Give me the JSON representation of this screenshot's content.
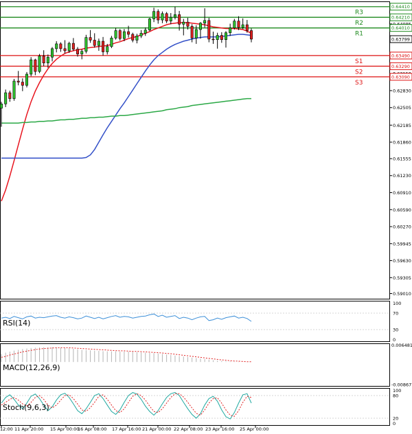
{
  "chart_data": {
    "type": "candlestick",
    "main": {
      "ylim": [
        0.589,
        0.6451
      ],
      "y_ticks": [
        0.6441,
        0.64085,
        0.6379,
        0.6347,
        0.6315,
        0.6283,
        0.6251,
        0.6218,
        0.6186,
        0.6155,
        0.6123,
        0.6091,
        0.6059,
        0.6027,
        0.5995,
        0.5963,
        0.5931,
        0.5901
      ],
      "y_tick_labels": [
        "0.64410",
        "0.64085",
        "0.63799",
        "0.63470",
        "0.63150",
        "0.62830",
        "0.62505",
        "0.62185",
        "0.61860",
        "0.61555",
        "0.61230",
        "0.60910",
        "0.60590",
        "0.60270",
        "0.59945",
        "0.59630",
        "0.59305",
        "0.59010"
      ],
      "levels": [
        {
          "label": "R3",
          "value": 0.6441,
          "tag": "0.64410",
          "color": "#1e8a1e"
        },
        {
          "label": "R2",
          "value": 0.6421,
          "tag": "0.64210",
          "color": "#1e8a1e"
        },
        {
          "label": "R1",
          "value": 0.6401,
          "tag": "0.64010",
          "color": "#1e8a1e"
        },
        {
          "label": "S1",
          "value": 0.6349,
          "tag": "0.63490",
          "color": "#dd1111"
        },
        {
          "label": "S2",
          "value": 0.6329,
          "tag": "0.63290",
          "color": "#dd1111"
        },
        {
          "label": "S3",
          "value": 0.6309,
          "tag": "0.63090",
          "color": "#dd1111"
        }
      ],
      "current_price": {
        "value": 0.63799,
        "tag": "0.63799"
      },
      "candles_ohlc": [
        [
          0.625,
          0.6262,
          0.6215,
          0.6258
        ],
        [
          0.6258,
          0.6285,
          0.6252,
          0.6279
        ],
        [
          0.6279,
          0.6283,
          0.6262,
          0.6268
        ],
        [
          0.6268,
          0.6305,
          0.6264,
          0.6301
        ],
        [
          0.6301,
          0.632,
          0.6293,
          0.6299
        ],
        [
          0.6299,
          0.6306,
          0.6282,
          0.6293
        ],
        [
          0.6293,
          0.6318,
          0.6289,
          0.6314
        ],
        [
          0.6314,
          0.6346,
          0.631,
          0.6341
        ],
        [
          0.6341,
          0.6343,
          0.6312,
          0.6319
        ],
        [
          0.6319,
          0.6352,
          0.6316,
          0.6348
        ],
        [
          0.6348,
          0.6359,
          0.6329,
          0.6335
        ],
        [
          0.6335,
          0.6351,
          0.6326,
          0.6346
        ],
        [
          0.6346,
          0.6365,
          0.6338,
          0.6362
        ],
        [
          0.6362,
          0.6376,
          0.6355,
          0.6371
        ],
        [
          0.6371,
          0.6374,
          0.6356,
          0.6362
        ],
        [
          0.6362,
          0.6378,
          0.6353,
          0.6358
        ],
        [
          0.6358,
          0.6375,
          0.6354,
          0.6372
        ],
        [
          0.6372,
          0.6382,
          0.6358,
          0.6361
        ],
        [
          0.6361,
          0.6365,
          0.6347,
          0.6352
        ],
        [
          0.6352,
          0.6361,
          0.6342,
          0.6357
        ],
        [
          0.6357,
          0.6388,
          0.6353,
          0.6383
        ],
        [
          0.6383,
          0.6397,
          0.6373,
          0.6378
        ],
        [
          0.6378,
          0.6391,
          0.6364,
          0.6368
        ],
        [
          0.6368,
          0.6381,
          0.6358,
          0.6376
        ],
        [
          0.6376,
          0.6384,
          0.6349,
          0.6356
        ],
        [
          0.6356,
          0.6371,
          0.6351,
          0.6366
        ],
        [
          0.6366,
          0.6386,
          0.6363,
          0.6382
        ],
        [
          0.6382,
          0.6401,
          0.6379,
          0.6396
        ],
        [
          0.6396,
          0.6399,
          0.6377,
          0.6381
        ],
        [
          0.6381,
          0.6399,
          0.6376,
          0.6394
        ],
        [
          0.6394,
          0.6405,
          0.6383,
          0.6389
        ],
        [
          0.6389,
          0.6392,
          0.6374,
          0.6378
        ],
        [
          0.6378,
          0.639,
          0.6372,
          0.6386
        ],
        [
          0.6386,
          0.6397,
          0.6382,
          0.6391
        ],
        [
          0.6391,
          0.6402,
          0.6386,
          0.6397
        ],
        [
          0.6397,
          0.642,
          0.6395,
          0.6418
        ],
        [
          0.6418,
          0.6439,
          0.6412,
          0.6432
        ],
        [
          0.6432,
          0.6436,
          0.6409,
          0.6416
        ],
        [
          0.6416,
          0.6432,
          0.641,
          0.6428
        ],
        [
          0.6428,
          0.6431,
          0.641,
          0.6414
        ],
        [
          0.6414,
          0.6429,
          0.6408,
          0.6421
        ],
        [
          0.6421,
          0.6441,
          0.6417,
          0.6426
        ],
        [
          0.6426,
          0.6433,
          0.6396,
          0.6408
        ],
        [
          0.6408,
          0.6418,
          0.6387,
          0.6412
        ],
        [
          0.6412,
          0.642,
          0.6398,
          0.6404
        ],
        [
          0.6404,
          0.6408,
          0.6374,
          0.6382
        ],
        [
          0.6382,
          0.6406,
          0.6371,
          0.6398
        ],
        [
          0.6398,
          0.6412,
          0.6381,
          0.641
        ],
        [
          0.641,
          0.6438,
          0.6402,
          0.6415
        ],
        [
          0.6415,
          0.642,
          0.6374,
          0.638
        ],
        [
          0.638,
          0.6394,
          0.6371,
          0.6379
        ],
        [
          0.6379,
          0.6392,
          0.6362,
          0.6387
        ],
        [
          0.6387,
          0.6393,
          0.6373,
          0.6379
        ],
        [
          0.6379,
          0.6395,
          0.6364,
          0.6392
        ],
        [
          0.6392,
          0.6409,
          0.6386,
          0.6401
        ],
        [
          0.6401,
          0.6418,
          0.6398,
          0.6414
        ],
        [
          0.6414,
          0.6423,
          0.6397,
          0.6402
        ],
        [
          0.6402,
          0.6419,
          0.6399,
          0.6407
        ],
        [
          0.6407,
          0.6416,
          0.6392,
          0.6396
        ],
        [
          0.6396,
          0.64,
          0.6374,
          0.638
        ]
      ],
      "moving_averages": [
        {
          "color": "#e8141e",
          "values": [
            0.6075,
            0.6096,
            0.6122,
            0.6151,
            0.6181,
            0.621,
            0.6238,
            0.6262,
            0.6282,
            0.6298,
            0.6312,
            0.6324,
            0.6334,
            0.6342,
            0.6348,
            0.6353,
            0.6356,
            0.6358,
            0.636,
            0.6361,
            0.6363,
            0.6364,
            0.6365,
            0.6366,
            0.6367,
            0.6368,
            0.637,
            0.6373,
            0.6375,
            0.6378,
            0.6381,
            0.6383,
            0.6385,
            0.6388,
            0.6391,
            0.6394,
            0.6398,
            0.6401,
            0.6404,
            0.6407,
            0.6409,
            0.641,
            0.6411,
            0.6411,
            0.6411,
            0.641,
            0.6409,
            0.6408,
            0.6407,
            0.6405,
            0.6403,
            0.6402,
            0.6401,
            0.64,
            0.64,
            0.64,
            0.6399,
            0.6398,
            0.6395,
            0.6391
          ]
        },
        {
          "color": "#3350c8",
          "values": [
            0.6156,
            0.6156,
            0.6156,
            0.6156,
            0.6156,
            0.6156,
            0.6156,
            0.6156,
            0.6156,
            0.6156,
            0.6156,
            0.6156,
            0.6156,
            0.6156,
            0.6156,
            0.6156,
            0.6156,
            0.6156,
            0.6156,
            0.6156,
            0.6157,
            0.6162,
            0.6172,
            0.6186,
            0.62,
            0.6213,
            0.6225,
            0.6237,
            0.6249,
            0.626,
            0.6272,
            0.6284,
            0.6296,
            0.6308,
            0.632,
            0.6331,
            0.6341,
            0.6349,
            0.6355,
            0.6361,
            0.6366,
            0.637,
            0.6373,
            0.6376,
            0.6378,
            0.638,
            0.6382,
            0.6383,
            0.6384,
            0.6384,
            0.6384,
            0.6384,
            0.6385,
            0.6386,
            0.6387,
            0.6388,
            0.6389,
            0.6389,
            0.6388,
            0.6387
          ]
        },
        {
          "color": "#2aa845",
          "values": [
            0.6222,
            0.6222,
            0.6222,
            0.6222,
            0.6222,
            0.6223,
            0.6223,
            0.6224,
            0.6224,
            0.6225,
            0.6225,
            0.6226,
            0.6226,
            0.6227,
            0.6228,
            0.6228,
            0.6229,
            0.6229,
            0.623,
            0.6231,
            0.6231,
            0.6232,
            0.6232,
            0.6233,
            0.6233,
            0.6234,
            0.6235,
            0.6235,
            0.6236,
            0.6236,
            0.6237,
            0.6238,
            0.6239,
            0.624,
            0.6241,
            0.6242,
            0.6243,
            0.6244,
            0.6245,
            0.6247,
            0.6248,
            0.6249,
            0.6251,
            0.6252,
            0.6253,
            0.6255,
            0.6256,
            0.6257,
            0.6258,
            0.6259,
            0.626,
            0.6261,
            0.6262,
            0.6263,
            0.6264,
            0.6265,
            0.6266,
            0.6267,
            0.6268,
            0.6268
          ]
        }
      ]
    },
    "x_labels": [
      "12:00",
      "11 Apr 20:00",
      "15 Apr 00:00",
      "16 Apr 08:00",
      "17 Apr 16:00",
      "21 Apr 00:00",
      "22 Apr 08:00",
      "23 Apr 16:00",
      "25 Apr 00:00"
    ],
    "rsi": {
      "label": "RSI(14)",
      "ylim": [
        0,
        100
      ],
      "ticks": [
        100,
        70,
        30,
        0
      ],
      "tick_labels": [
        "100",
        "70",
        "30",
        "0"
      ],
      "values": [
        58,
        60,
        57,
        62,
        59,
        56,
        61,
        63,
        58,
        60,
        59,
        61,
        63,
        64,
        60,
        58,
        61,
        59,
        56,
        58,
        63,
        60,
        57,
        60,
        56,
        59,
        62,
        64,
        60,
        62,
        61,
        58,
        60,
        62,
        63,
        66,
        68,
        62,
        65,
        60,
        62,
        64,
        57,
        60,
        58,
        54,
        58,
        61,
        62,
        52,
        54,
        58,
        55,
        59,
        61,
        63,
        58,
        60,
        57,
        50
      ]
    },
    "macd": {
      "label": "MACD(12,26,9)",
      "ylim": [
        -0.0095,
        0.0072
      ],
      "ticks": [
        0.006481,
        -0.008677
      ],
      "tick_labels": [
        "0.006481",
        "-0.008677"
      ],
      "histogram": [
        0.0031,
        0.0036,
        0.004,
        0.0044,
        0.0047,
        0.005,
        0.0052,
        0.0054,
        0.0055,
        0.0056,
        0.0057,
        0.0057,
        0.0057,
        0.0056,
        0.0055,
        0.0054,
        0.0053,
        0.0051,
        0.0049,
        0.0047,
        0.0046,
        0.0045,
        0.0044,
        0.0043,
        0.0042,
        0.0041,
        0.0041,
        0.0041,
        0.004,
        0.004,
        0.004,
        0.0039,
        0.0038,
        0.0037,
        0.0036,
        0.0035,
        0.0034,
        0.0033,
        0.0031,
        0.0029,
        0.0027,
        0.0025,
        0.0023,
        0.0021,
        0.0019,
        0.0017,
        0.0015,
        0.0013,
        0.0011,
        0.0009,
        0.0007,
        0.0005,
        0.0004,
        0.0003,
        0.0002,
        0.0001,
        0.0001,
        0.0,
        0.0,
        0.0
      ],
      "signal": [
        0.0018,
        0.0022,
        0.0027,
        0.0031,
        0.0035,
        0.0039,
        0.0042,
        0.0045,
        0.0048,
        0.005,
        0.0052,
        0.0053,
        0.0054,
        0.0055,
        0.0055,
        0.0055,
        0.0055,
        0.0054,
        0.0053,
        0.0052,
        0.0051,
        0.005,
        0.0049,
        0.0048,
        0.0047,
        0.0046,
        0.0045,
        0.0044,
        0.0043,
        0.0043,
        0.0042,
        0.0041,
        0.0041,
        0.004,
        0.0039,
        0.0038,
        0.0037,
        0.0036,
        0.0035,
        0.0033,
        0.0032,
        0.003,
        0.0028,
        0.0026,
        0.0024,
        0.0022,
        0.002,
        0.0018,
        0.0016,
        0.0014,
        0.0012,
        0.001,
        0.0008,
        0.0007,
        0.0005,
        0.0004,
        0.0003,
        0.0002,
        0.0001,
        0.0001
      ]
    },
    "stoch": {
      "label": "Stoch(9,6,3)",
      "ylim": [
        0,
        100
      ],
      "ticks": [
        100,
        80,
        20,
        0
      ],
      "tick_labels": [
        "100",
        "80",
        "20",
        "0"
      ],
      "k": [
        60,
        75,
        82,
        70,
        55,
        45,
        60,
        78,
        84,
        72,
        55,
        40,
        50,
        68,
        82,
        86,
        75,
        58,
        40,
        32,
        45,
        62,
        80,
        85,
        72,
        55,
        38,
        30,
        42,
        62,
        80,
        88,
        84,
        70,
        52,
        38,
        28,
        40,
        58,
        75,
        85,
        88,
        80,
        62,
        45,
        30,
        20,
        32,
        55,
        72,
        78,
        65,
        42,
        24,
        18,
        35,
        60,
        82,
        85,
        60
      ],
      "d": [
        55,
        62,
        70,
        75,
        68,
        58,
        52,
        62,
        75,
        80,
        70,
        55,
        47,
        55,
        68,
        80,
        82,
        72,
        57,
        42,
        38,
        48,
        62,
        78,
        82,
        70,
        55,
        40,
        35,
        45,
        62,
        78,
        85,
        80,
        68,
        52,
        38,
        35,
        45,
        60,
        75,
        85,
        85,
        76,
        62,
        47,
        33,
        28,
        42,
        60,
        72,
        74,
        60,
        42,
        28,
        25,
        40,
        62,
        78,
        75
      ]
    }
  }
}
